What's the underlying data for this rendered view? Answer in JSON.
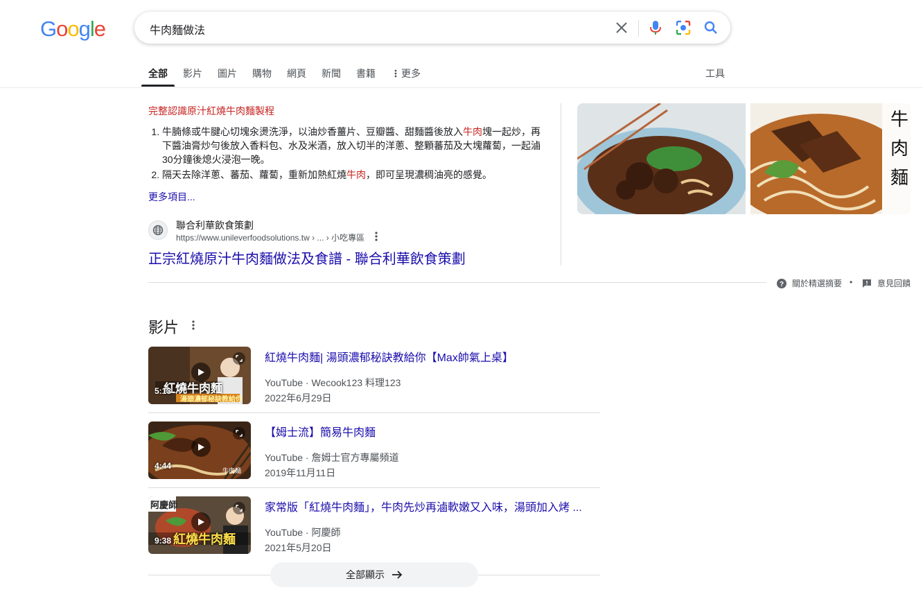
{
  "logo": [
    "G",
    "o",
    "o",
    "g",
    "l",
    "e"
  ],
  "logo_colors": [
    "#4285f4",
    "#ea4335",
    "#fbbc05",
    "#4285f4",
    "#34a853",
    "#ea4335"
  ],
  "search": {
    "query": "牛肉麵做法"
  },
  "tabs": [
    {
      "label": "全部"
    },
    {
      "label": "影片"
    },
    {
      "label": "圖片"
    },
    {
      "label": "購物"
    },
    {
      "label": "網頁"
    },
    {
      "label": "新聞"
    },
    {
      "label": "書籍"
    },
    {
      "label": "更多"
    }
  ],
  "tools_label": "工具",
  "featured": {
    "heading": "完整認識原汁紅燒牛肉麵製程",
    "steps": [
      {
        "pre": "牛腩條或牛腱心切塊汆燙洗淨，以油炒香薑片、豆瓣醬、甜麵醬後放入",
        "hl": "牛肉",
        "post": "塊一起炒，再下醬油膏炒勻後放入香料包、水及米酒，放入切半的洋蔥、整顆蕃茄及大塊蘿蔔，一起滷30分鐘後熄火浸泡一晚。"
      },
      {
        "pre": "隔天去除洋蔥、蕃茄、蘿蔔，重新加熱紅燒",
        "hl": "牛肉",
        "post": "，即可呈現濃稠油亮的感覺。"
      }
    ],
    "more_items": "更多項目...",
    "source_name": "聯合利華飲食策劃",
    "source_url": "https://www.unileverfoodsolutions.tw › ... › 小吃專區",
    "result_title": "正宗紅燒原汁牛肉麵做法及食譜 - 聯合利華飲食策劃",
    "image_caption": "牛肉麵",
    "about_label": "關於精選摘要",
    "dot": "•",
    "feedback_label": "意見回饋"
  },
  "videos_section": {
    "heading": "影片",
    "items": [
      {
        "title": "紅燒牛肉麵| 湯頭濃郁秘訣教給你【Max帥氣上桌】",
        "platform": "YouTube",
        "channel": "Wecook123 料理123",
        "date": "2022年6月29日",
        "duration": "5:13",
        "thumb_text": "紅燒牛肉麵",
        "thumb_sub": "湯頭濃郁秘訣教給你"
      },
      {
        "title": "【姆士流】簡易牛肉麵",
        "platform": "YouTube",
        "channel": "詹姆士官方專屬頻道",
        "date": "2019年11月11日",
        "duration": "4:44",
        "thumb_text": "牛肉麵",
        "thumb_sub": ""
      },
      {
        "title": "家常版「紅燒牛肉麵」，牛肉先炒再滷軟嫩又入味，湯頭加入烤 ...",
        "platform": "YouTube",
        "channel": "阿慶師",
        "date": "2021年5月20日",
        "duration": "9:38",
        "thumb_text": "紅燒牛肉麵",
        "thumb_sub": "阿慶師"
      }
    ],
    "meta_sep": " · ",
    "show_all": "全部顯示"
  }
}
